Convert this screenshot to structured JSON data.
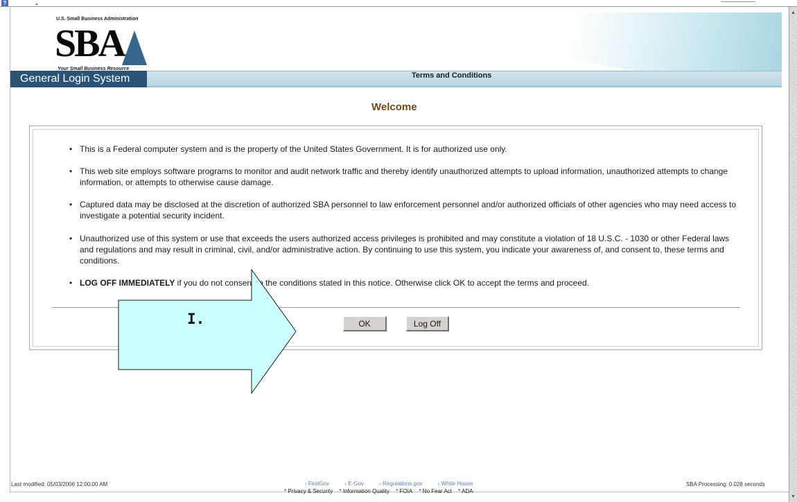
{
  "header": {
    "agency_line": "U.S. Small Business Administration",
    "logo_text": "SBA",
    "tagline": "Your Small Business Resource",
    "system_name": "General Login System",
    "page_title": "Terms and Conditions"
  },
  "main": {
    "welcome": "Welcome",
    "terms": [
      {
        "text": "This is a Federal computer system and is the property of the United States Government. It is for authorized use only."
      },
      {
        "text": "This web site employs software programs to monitor and audit network traffic and thereby identify unauthorized attempts to upload information, unauthorized attempts to change information, or attempts to otherwise cause damage."
      },
      {
        "text": "Captured data may be disclosed at the discretion of authorized SBA personnel to law enforcement personnel and/or authorized officials of other agencies who may need access to investigate a potential security incident."
      },
      {
        "text": "Unauthorized use of this system or use that exceeds the users authorized access privileges is prohibited and may constitute a violation of 18 U.S.C. - 1030 or other Federal laws and regulations and may result in criminal, civil, and/or administrative action. By continuing to use this system, you indicate your awareness of, and consent to, these terms and conditions."
      },
      {
        "lead": "LOG OFF IMMEDIATELY",
        "text": " if you do not consent to the conditions stated in this notice. Otherwise click OK to accept the terms and proceed."
      }
    ],
    "ok_label": "OK",
    "logoff_label": "Log Off"
  },
  "annotation": {
    "label": "I.",
    "fill_color": "#ccffff"
  },
  "footer": {
    "last_modified": "Last modified: 05/03/2006 12:00:00 AM",
    "processing": "SBA Processing:  0.028 seconds",
    "links": [
      "FirstGov",
      "E-Gov",
      "Regulations.gov",
      "White House"
    ],
    "policies": [
      "* Privacy & Security",
      "* Information Quality",
      "* FOIA",
      "* No Fear Act",
      "* ADA"
    ]
  },
  "colors": {
    "system_tab": "#2b5376",
    "welcome": "#6b4a1d",
    "link": "#5a7fc0"
  }
}
